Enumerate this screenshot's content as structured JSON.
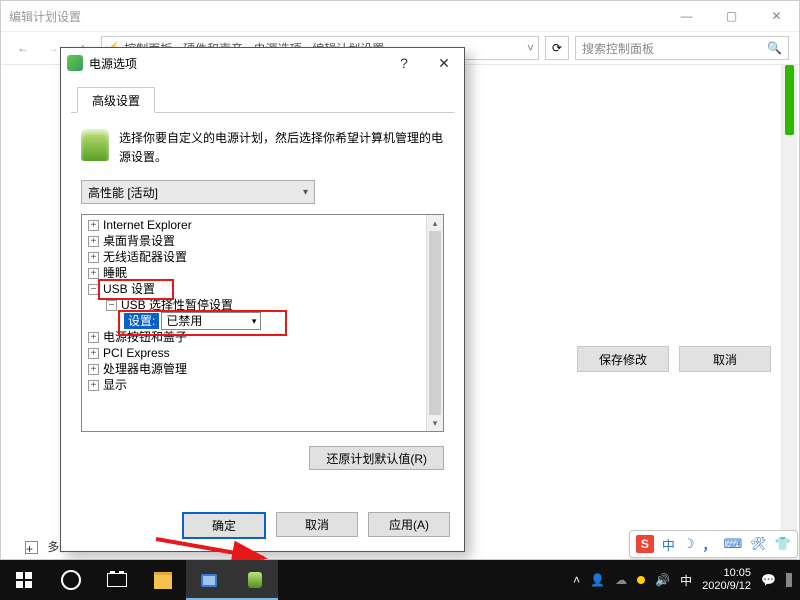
{
  "parent_window": {
    "title": "编辑计划设置",
    "address_text": "控制面板 › 硬件和声音 › 电源选项 › 编辑计划设置",
    "search_placeholder": "搜索控制面板",
    "save_button": "保存修改",
    "cancel_button": "取消",
    "truncated_item": "多任务处理"
  },
  "dialog": {
    "title": "电源选项",
    "tab": "高级设置",
    "description": "选择你要自定义的电源计划，然后选择你希望计算机管理的电源设置。",
    "plan_selected": "高性能 [活动]",
    "tree": {
      "items": [
        {
          "label": "Internet Explorer",
          "level": 0,
          "expandable": "+"
        },
        {
          "label": "桌面背景设置",
          "level": 0,
          "expandable": "+"
        },
        {
          "label": "无线适配器设置",
          "level": 0,
          "expandable": "+"
        },
        {
          "label": "睡眠",
          "level": 0,
          "expandable": "+"
        },
        {
          "label": "USB 设置",
          "level": 0,
          "expandable": "−"
        },
        {
          "label": "USB 选择性暂停设置",
          "level": 1,
          "expandable": "−"
        },
        {
          "label": "设置:",
          "level": 2,
          "value": "已禁用",
          "is_setting": true
        },
        {
          "label": "电源按钮和盖子",
          "level": 0,
          "expandable": "+"
        },
        {
          "label": "PCI Express",
          "level": 0,
          "expandable": "+"
        },
        {
          "label": "处理器电源管理",
          "level": 0,
          "expandable": "+"
        },
        {
          "label": "显示",
          "level": 0,
          "expandable": "+"
        }
      ]
    },
    "restore_defaults": "还原计划默认值(R)",
    "ok": "确定",
    "cancel": "取消",
    "apply": "应用(A)"
  },
  "ime": {
    "lang": "中",
    "moon": "☽",
    "punct": "，",
    "kbd": "⌨",
    "tool": "🛠",
    "shirt": "👕"
  },
  "taskbar": {
    "tray_up": "˄",
    "people": "👤",
    "ime_lang": "中",
    "volume": "🔊",
    "time": "10:05",
    "date": "2020/9/12",
    "notif": "💬"
  }
}
